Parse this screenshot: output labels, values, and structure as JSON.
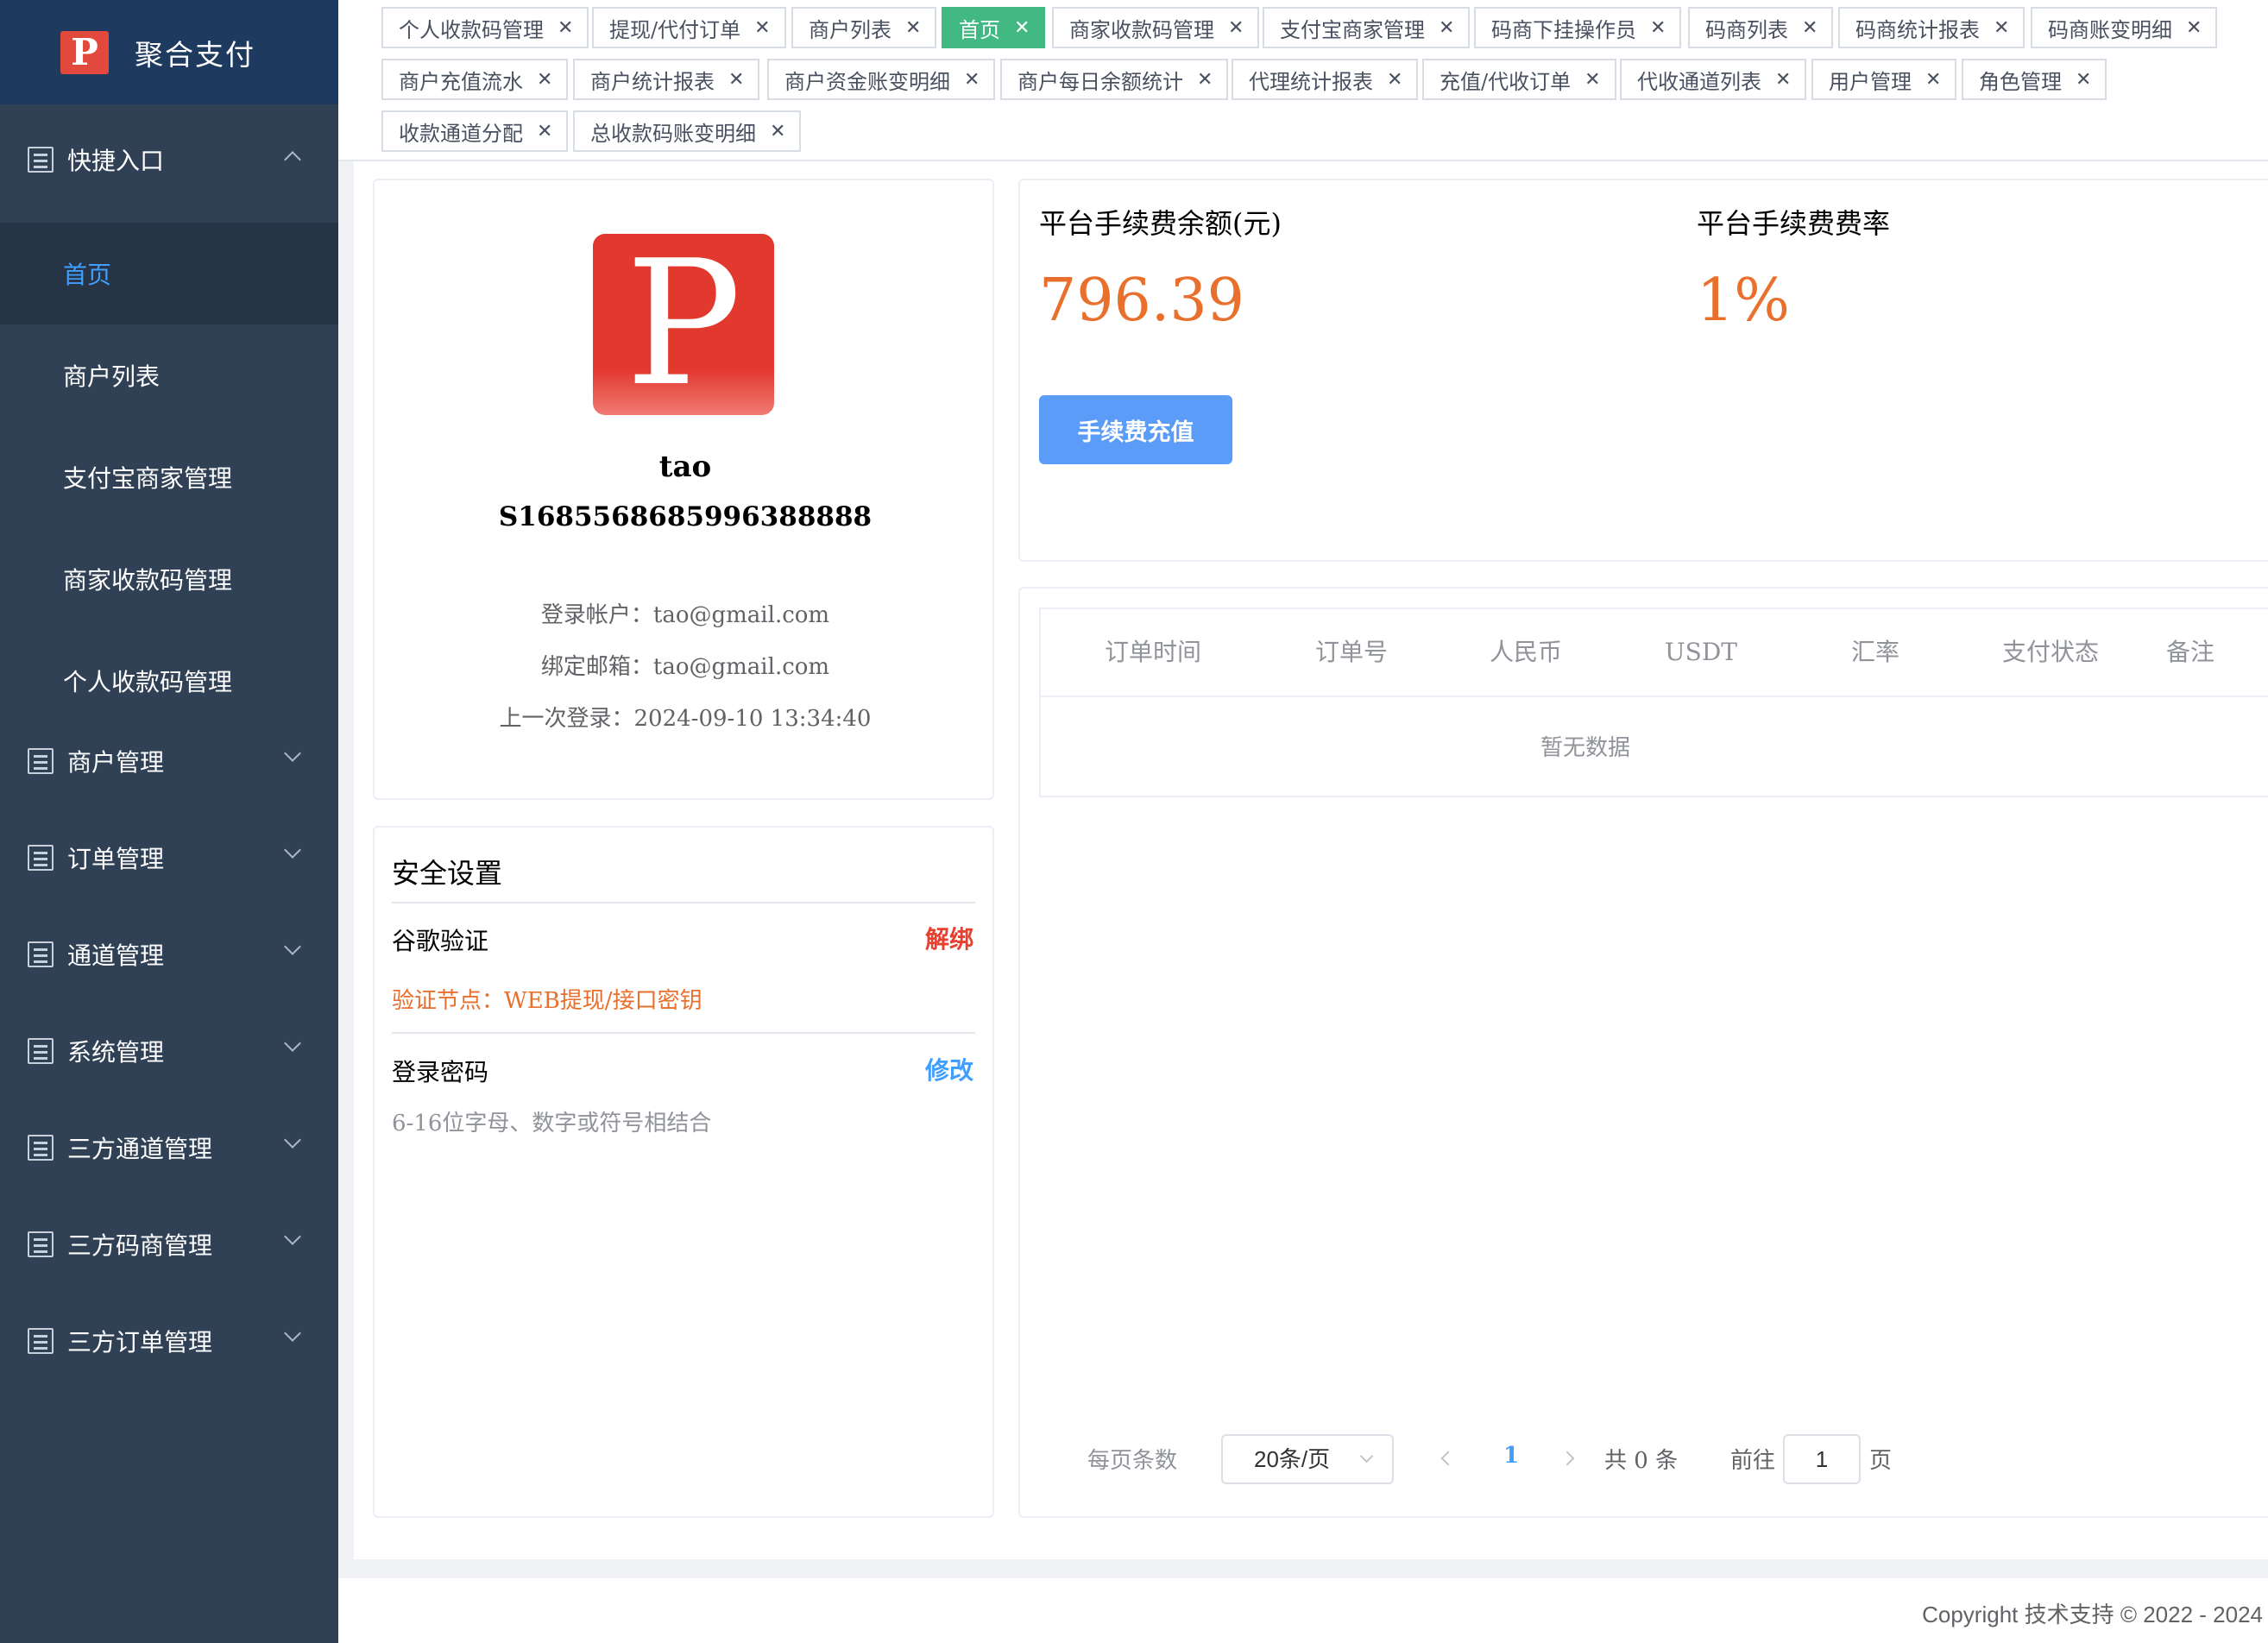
{
  "brand": {
    "logo_letter": "P",
    "name": "聚合支付"
  },
  "sidebar": {
    "top_group": "快捷入口",
    "sub_items": [
      {
        "label": "首页",
        "active": true
      },
      {
        "label": "商户列表"
      },
      {
        "label": "支付宝商家管理"
      },
      {
        "label": "商家收款码管理"
      },
      {
        "label": "个人收款码管理"
      }
    ],
    "groups": [
      {
        "label": "商户管理"
      },
      {
        "label": "订单管理"
      },
      {
        "label": "通道管理"
      },
      {
        "label": "系统管理"
      },
      {
        "label": "三方通道管理"
      },
      {
        "label": "三方码商管理"
      },
      {
        "label": "三方订单管理"
      }
    ]
  },
  "tags": [
    {
      "label": "个人收款码管理"
    },
    {
      "label": "提现/代付订单"
    },
    {
      "label": "商户列表"
    },
    {
      "label": "首页",
      "active": true
    },
    {
      "label": "商家收款码管理"
    },
    {
      "label": "支付宝商家管理"
    },
    {
      "label": "码商下挂操作员"
    },
    {
      "label": "码商列表"
    },
    {
      "label": "码商统计报表"
    },
    {
      "label": "码商账变明细"
    },
    {
      "label": "商户充值流水"
    },
    {
      "label": "商户统计报表"
    },
    {
      "label": "商户资金账变明细"
    },
    {
      "label": "商户每日余额统计"
    },
    {
      "label": "代理统计报表"
    },
    {
      "label": "充值/代收订单"
    },
    {
      "label": "代收通道列表"
    },
    {
      "label": "用户管理"
    },
    {
      "label": "角色管理"
    },
    {
      "label": "收款通道分配"
    },
    {
      "label": "总收款码账变明细"
    }
  ],
  "tag_close_glyph": "✕",
  "profile": {
    "avatar_letter": "P",
    "name": "tao",
    "id": "S1685568685996388888",
    "login_account": "登录帐户：tao@gmail.com",
    "bound_email": "绑定邮箱：tao@gmail.com",
    "last_login": "上一次登录：2024-09-10 13:34:40"
  },
  "security": {
    "title": "安全设置",
    "google_auth_label": "谷歌验证",
    "google_auth_action": "解绑",
    "google_auth_desc": "验证节点：WEB提现/接口密钥",
    "password_label": "登录密码",
    "password_action": "修改",
    "password_desc": "6-16位字母、数字或符号相结合"
  },
  "fee": {
    "balance_label": "平台手续费余额(元)",
    "balance_value": "796.39",
    "rate_label": "平台手续费费率",
    "rate_value": "1%",
    "recharge_button": "手续费充值"
  },
  "orders_table": {
    "columns": [
      "订单时间",
      "订单号",
      "人民币",
      "USDT",
      "汇率",
      "支付状态",
      "备注"
    ],
    "empty_text": "暂无数据"
  },
  "pagination": {
    "per_page_label": "每页条数",
    "page_size": "20条/页",
    "current_page": "1",
    "total": "共 0 条",
    "goto_label": "前往",
    "goto_value": "1",
    "page_unit": "页"
  },
  "footer": {
    "copyright": "Copyright 技术支持 © 2022 - 2024"
  },
  "colors": {
    "sidebar_bg": "#304156",
    "brand_bg": "#1f3a5f",
    "active_tag": "#42b983",
    "accent_blue": "#409eff",
    "fee_orange": "#e96f2c",
    "danger_red": "#f56c6c"
  }
}
